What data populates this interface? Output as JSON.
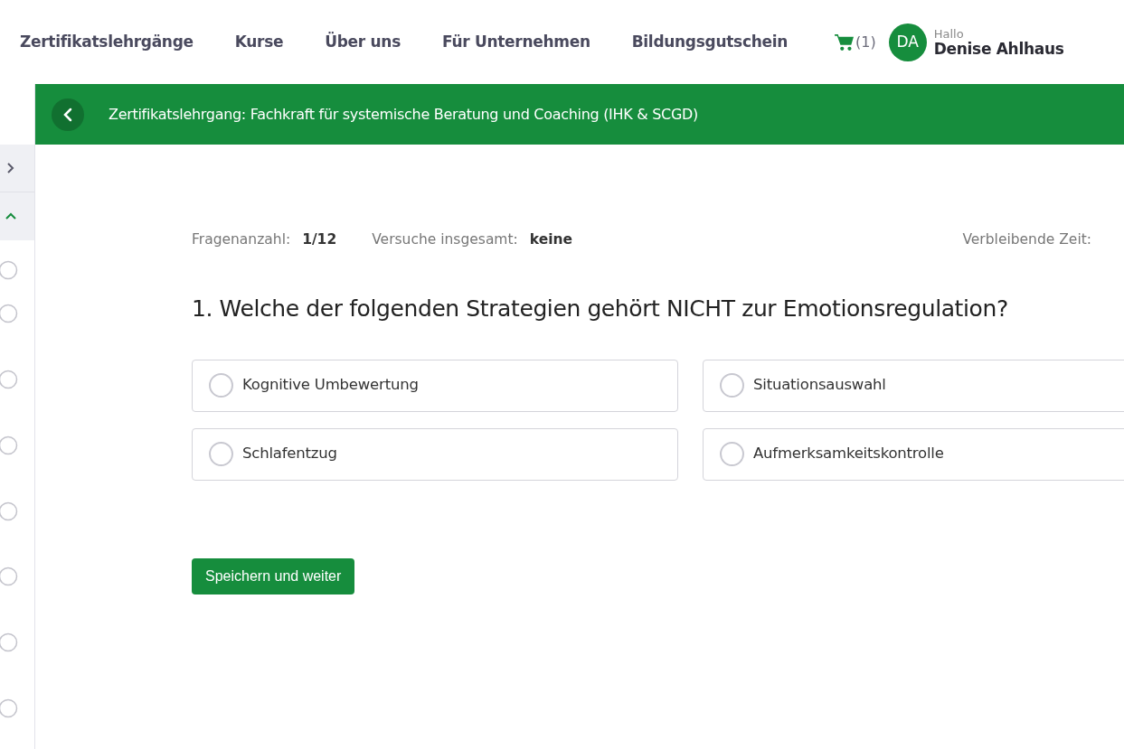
{
  "nav": {
    "items": [
      "Zertifikatslehrgänge",
      "Kurse",
      "Über uns",
      "Für Unternehmen",
      "Bildungsgutschein"
    ],
    "cart_count": "(1)",
    "user": {
      "initials": "DA",
      "greeting": "Hallo",
      "name": "Denise Ahlhaus"
    }
  },
  "course_bar": {
    "title": "Zertifikatslehrgang: Fachkraft für systemische Beratung und Coaching (IHK & SCGD)"
  },
  "sidebar": {
    "collapsed_row": {
      "expanded": false
    },
    "section_row": {
      "expanded": true
    },
    "lessons": [
      {
        "completed": false
      },
      {
        "completed": false
      },
      {
        "completed": false
      },
      {
        "completed": false
      },
      {
        "completed": false
      },
      {
        "completed": false
      },
      {
        "completed": false
      },
      {
        "completed": false
      }
    ]
  },
  "quiz": {
    "question_count_label": "Fragenanzahl:",
    "question_count": "1/12",
    "attempts_label": "Versuche insgesamt:",
    "attempts": "keine",
    "time_label": "Verbleibende Zeit:",
    "question": "1. Welche der folgenden Strategien gehört NICHT zur Emotionsregulation?",
    "options": [
      {
        "label": "Kognitive Umbewertung",
        "selected": false
      },
      {
        "label": "Situationsauswahl",
        "selected": false
      },
      {
        "label": "Schlafentzug",
        "selected": false
      },
      {
        "label": "Aufmerksamkeitskontrolle",
        "selected": false
      }
    ],
    "submit": "Speichern und weiter"
  }
}
